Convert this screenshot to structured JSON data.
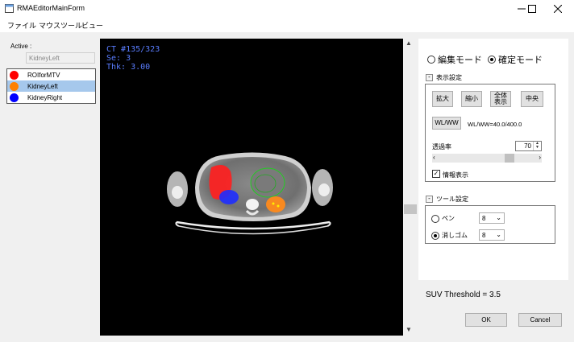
{
  "window": {
    "title": "RMAEditorMainForm",
    "minimize_icon": "minimize-icon",
    "maximize_icon": "maximize-icon",
    "close_icon": "close-icon"
  },
  "menu": [
    "ファイル",
    "マウスツール",
    "ビュー"
  ],
  "roi_panel": {
    "active_label": "Active :",
    "active_value": "KidneyLeft",
    "items": [
      {
        "name": "ROIforMTV",
        "color": "#ff0000",
        "selected": false
      },
      {
        "name": "KidneyLeft",
        "color": "#ff8000",
        "selected": true
      },
      {
        "name": "KidneyRight",
        "color": "#0000ff",
        "selected": false
      }
    ]
  },
  "viewer": {
    "overlay": [
      "CT  #135/323",
      "Se: 3",
      "Thk: 3.00"
    ],
    "overlay_color": "#5a7dff"
  },
  "mode": {
    "edit_label": "編集モード",
    "confirm_label": "確定モード",
    "selected": "confirm"
  },
  "display_settings": {
    "header": "表示設定",
    "zoom_in": "拡大",
    "zoom_out": "縮小",
    "fit_all_line1": "全体",
    "fit_all_line2": "表示",
    "center": "中央",
    "wl_button": "WL/WW",
    "wl_value": "WL/WW=40.0/400.0",
    "opacity_label": "透過率",
    "opacity_value": "70",
    "info_label": "情報表示",
    "info_checked": true
  },
  "tool_settings": {
    "header": "ツール設定",
    "pen_label": "ペン",
    "pen_size": "8",
    "eraser_label": "消しゴム",
    "eraser_size": "8",
    "selected": "eraser"
  },
  "suv_threshold": "SUV Threshold  =  3.5",
  "buttons": {
    "ok": "OK",
    "cancel": "Cancel"
  }
}
